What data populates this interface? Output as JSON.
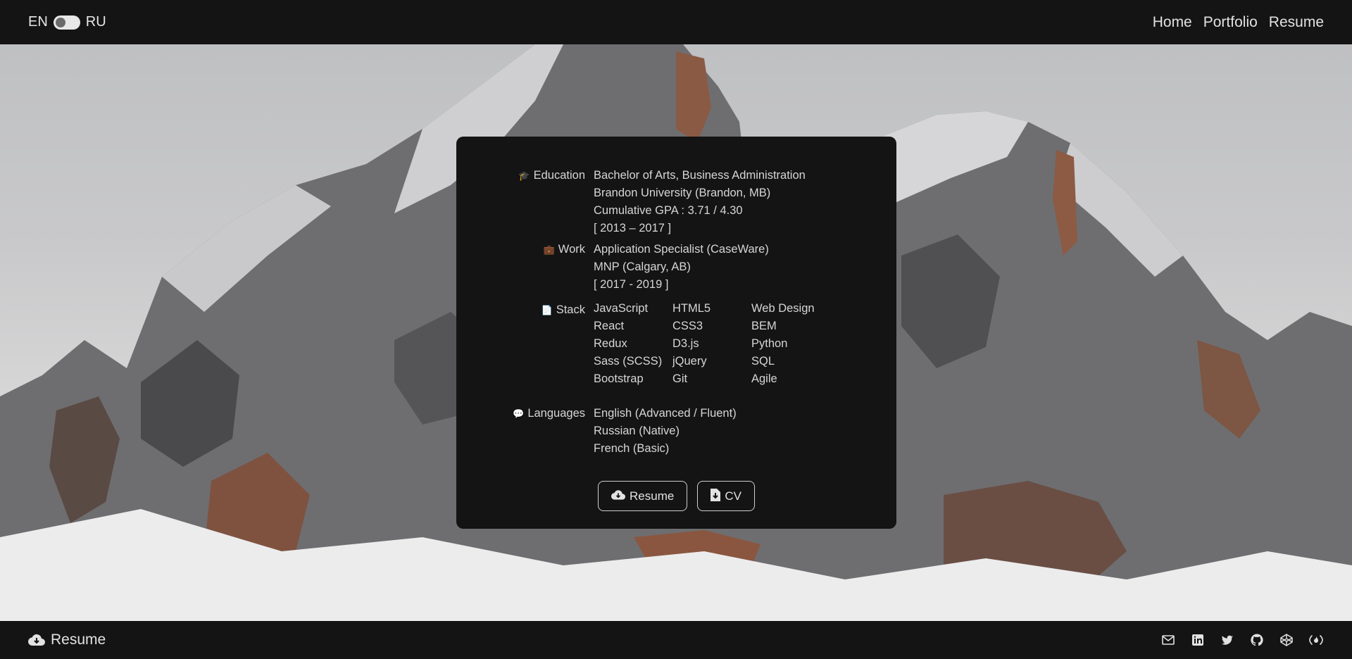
{
  "header": {
    "lang_en": "EN",
    "lang_ru": "RU",
    "nav": [
      "Home",
      "Portfolio",
      "Resume"
    ]
  },
  "education": {
    "label": "Education",
    "icon": "graduation-cap-icon",
    "lines": [
      "Bachelor of Arts, Business Administration",
      "Brandon University (Brandon, MB)",
      "Cumulative GPA : 3.71 / 4.30",
      "[ 2013 – 2017 ]"
    ]
  },
  "work": {
    "label": "Work",
    "icon": "briefcase-icon",
    "lines": [
      "Application Specialist (CaseWare)",
      "MNP (Calgary, AB)",
      "[ 2017 - 2019 ]"
    ]
  },
  "stack": {
    "label": "Stack",
    "icon": "code-file-icon",
    "items": [
      "JavaScript",
      "HTML5",
      "Web Design",
      "React",
      "CSS3",
      "BEM",
      "Redux",
      "D3.js",
      "Python",
      "Sass (SCSS)",
      "jQuery",
      "SQL",
      "Bootstrap",
      "Git",
      "Agile"
    ]
  },
  "languages": {
    "label": "Languages",
    "icon": "speech-bubble-icon",
    "lines": [
      "English (Advanced / Fluent)",
      "Russian (Native)",
      "French (Basic)"
    ]
  },
  "buttons": {
    "resume": "Resume",
    "cv": "CV"
  },
  "footer": {
    "resume_link": "Resume",
    "socials": [
      "mail-icon",
      "linkedin-icon",
      "twitter-icon",
      "github-icon",
      "codepen-icon",
      "freecodecamp-icon"
    ]
  },
  "colors": {
    "background": "#141414",
    "text": "#d6d6d6"
  }
}
